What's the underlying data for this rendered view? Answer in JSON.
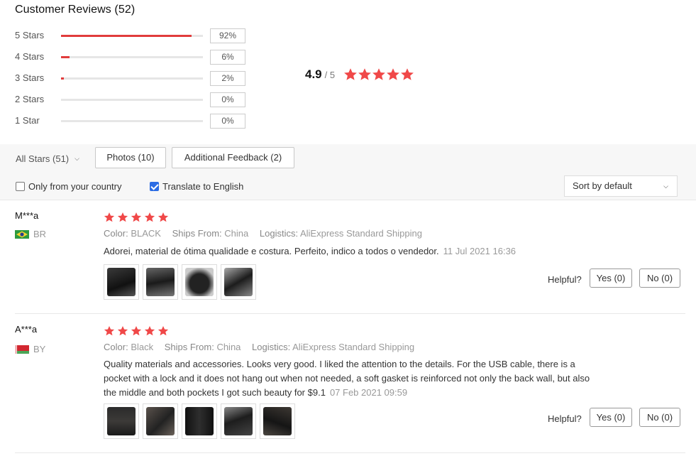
{
  "header": {
    "title": "Customer Reviews (52)"
  },
  "histogram": [
    {
      "label": "5 Stars",
      "percent_label": "92%",
      "fill_fraction": 0.92
    },
    {
      "label": "4 Stars",
      "percent_label": "6%",
      "fill_fraction": 0.06
    },
    {
      "label": "3 Stars",
      "percent_label": "2%",
      "fill_fraction": 0.02
    },
    {
      "label": "2 Stars",
      "percent_label": "0%",
      "fill_fraction": 0
    },
    {
      "label": "1 Star",
      "percent_label": "0%",
      "fill_fraction": 0
    }
  ],
  "average": {
    "value": "4.9",
    "denominator": "/ 5",
    "stars": 5
  },
  "filters": {
    "all_stars": "All Stars (51)",
    "photos": "Photos (10)",
    "additional": "Additional Feedback (2)",
    "only_country": "Only from your country",
    "only_country_checked": false,
    "translate": "Translate to English",
    "translate_checked": true,
    "sort": "Sort by default"
  },
  "reviews": [
    {
      "user": "M***a",
      "country": "BR",
      "flag_icon": "brazil-flag-icon",
      "stars": 5,
      "color_label": "Color:",
      "color": "BLACK",
      "ships_label": "Ships From:",
      "ships": "China",
      "logistics_label": "Logistics:",
      "logistics": "AliExpress Standard Shipping",
      "text": "Adorei, material de ótima qualidade e costura. Perfeito, indico a todos o vendedor.",
      "date": "11 Jul 2021 16:36",
      "thumb_count": 4,
      "helpful": "Helpful?",
      "yes": "Yes (0)",
      "no": "No (0)"
    },
    {
      "user": "A***a",
      "country": "BY",
      "flag_icon": "belarus-flag-icon",
      "stars": 5,
      "color_label": "Color:",
      "color": "Black",
      "ships_label": "Ships From:",
      "ships": "China",
      "logistics_label": "Logistics:",
      "logistics": "AliExpress Standard Shipping",
      "text": "Quality materials and accessories. Looks very good. I liked the attention to the details. For the USB cable, there is a pocket with a lock and it does not hang out when not needed, a soft gasket is reinforced not only the back wall, but also the middle and both pockets I got such beauty for $9.1",
      "date": "07 Feb 2021 09:59",
      "thumb_count": 5,
      "helpful": "Helpful?",
      "yes": "Yes (0)",
      "no": "No (0)"
    }
  ],
  "colors": {
    "accent": "#e13c3c",
    "star": "#f04848",
    "checkbox": "#2b6ce4"
  }
}
